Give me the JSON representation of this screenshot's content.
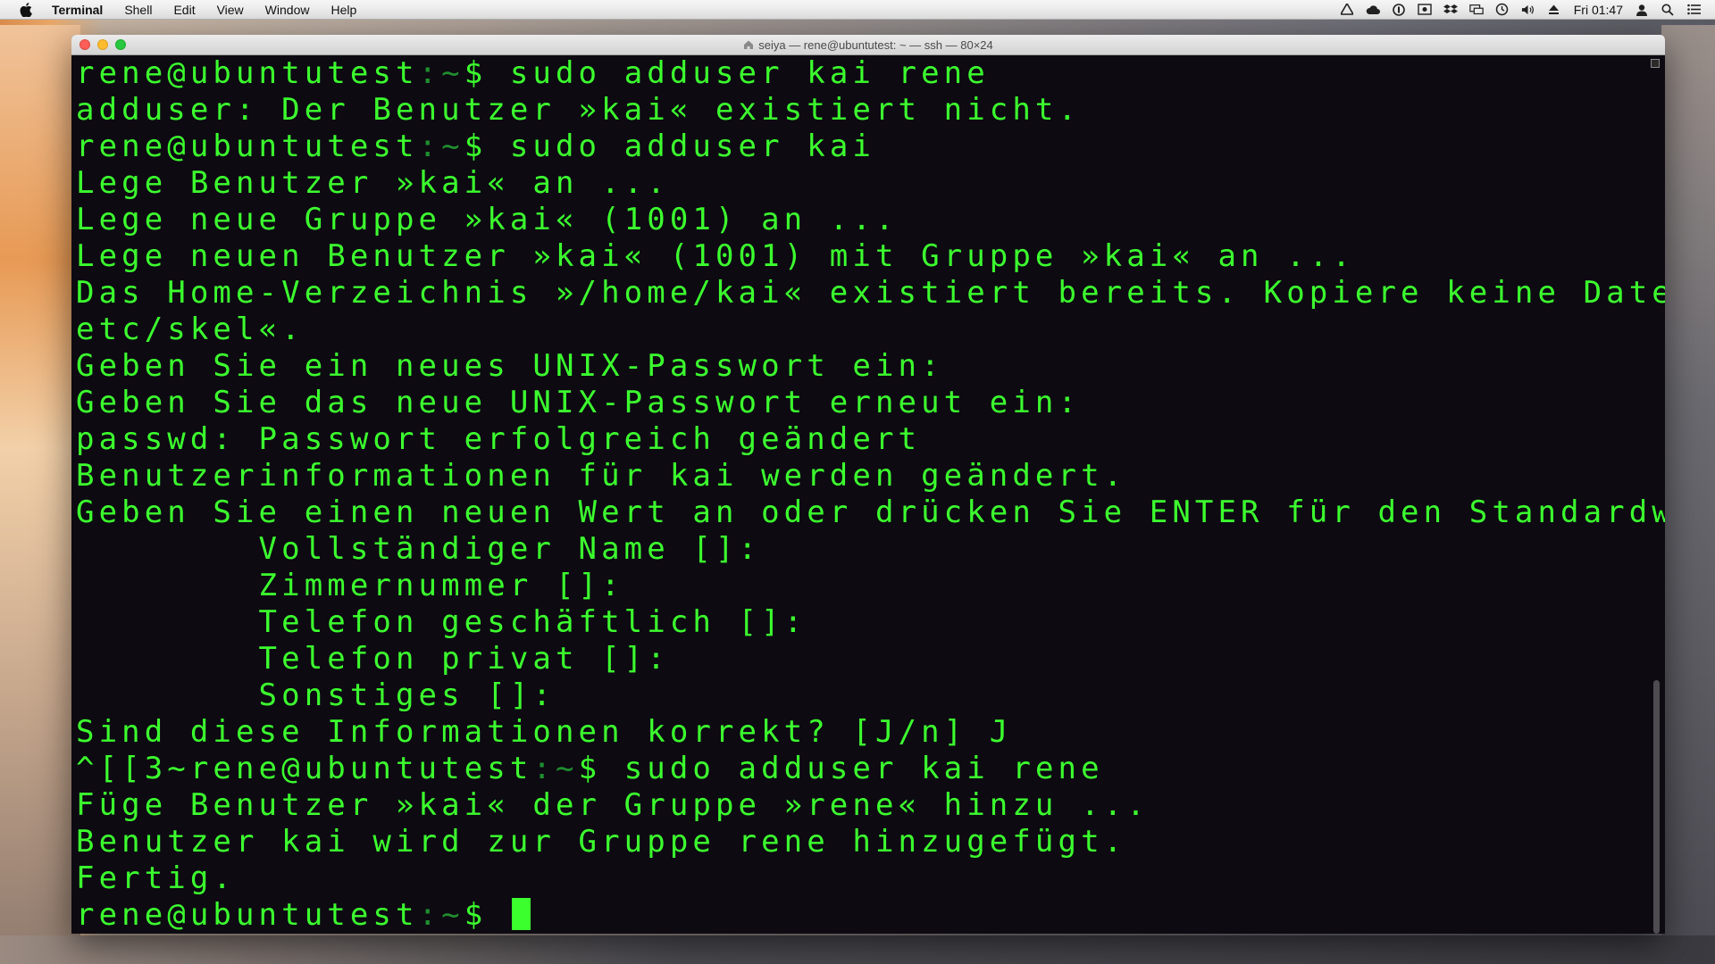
{
  "menubar": {
    "app_name": "Terminal",
    "items": [
      "Shell",
      "Edit",
      "View",
      "Window",
      "Help"
    ],
    "clock": "Fri 01:47"
  },
  "window": {
    "title": "seiya — rene@ubuntutest: ~ — ssh — 80×24"
  },
  "terminal": {
    "colors": {
      "text": "#3cff2e",
      "path": "#1f8f2e",
      "background": "#0d0a12"
    },
    "prompt": {
      "user_host": "rene@ubuntutest",
      "sep": ":",
      "path": "~",
      "symbol": "$ "
    },
    "lines": [
      {
        "type": "prompt",
        "cmd": "sudo adduser kai rene"
      },
      {
        "type": "text",
        "text": "adduser: Der Benutzer »kai« existiert nicht."
      },
      {
        "type": "prompt",
        "cmd": "sudo adduser kai"
      },
      {
        "type": "text",
        "text": "Lege Benutzer »kai« an ..."
      },
      {
        "type": "text",
        "text": "Lege neue Gruppe »kai« (1001) an ..."
      },
      {
        "type": "text",
        "text": "Lege neuen Benutzer »kai« (1001) mit Gruppe »kai« an ..."
      },
      {
        "type": "text",
        "text": "Das Home-Verzeichnis »/home/kai« existiert bereits. Kopiere keine Dateien aus »/"
      },
      {
        "type": "text",
        "text": "etc/skel«."
      },
      {
        "type": "text",
        "text": "Geben Sie ein neues UNIX-Passwort ein:"
      },
      {
        "type": "text",
        "text": "Geben Sie das neue UNIX-Passwort erneut ein:"
      },
      {
        "type": "text",
        "text": "passwd: Passwort erfolgreich geändert"
      },
      {
        "type": "text",
        "text": "Benutzerinformationen für kai werden geändert."
      },
      {
        "type": "text",
        "text": "Geben Sie einen neuen Wert an oder drücken Sie ENTER für den Standardwert"
      },
      {
        "type": "text",
        "text": "        Vollständiger Name []:"
      },
      {
        "type": "text",
        "text": "        Zimmernummer []:"
      },
      {
        "type": "text",
        "text": "        Telefon geschäftlich []:"
      },
      {
        "type": "text",
        "text": "        Telefon privat []:"
      },
      {
        "type": "text",
        "text": "        Sonstiges []:"
      },
      {
        "type": "text",
        "text": "Sind diese Informationen korrekt? [J/n] J"
      },
      {
        "type": "prompt",
        "prefix": "^[[3~",
        "cmd": "sudo adduser kai rene"
      },
      {
        "type": "text",
        "text": "Füge Benutzer »kai« der Gruppe »rene« hinzu ..."
      },
      {
        "type": "text",
        "text": "Benutzer kai wird zur Gruppe rene hinzugefügt."
      },
      {
        "type": "text",
        "text": "Fertig."
      },
      {
        "type": "prompt",
        "cmd": "",
        "cursor": true
      }
    ]
  },
  "icons": {
    "apple": "apple-icon",
    "status": [
      "drive-icon",
      "cloud-icon",
      "onepassword-icon",
      "screen-record-icon",
      "dropbox-icon",
      "display-icon",
      "time-machine-icon",
      "volume-icon",
      "eject-icon",
      "user-icon",
      "spotlight-search-icon",
      "notification-list-icon"
    ]
  }
}
